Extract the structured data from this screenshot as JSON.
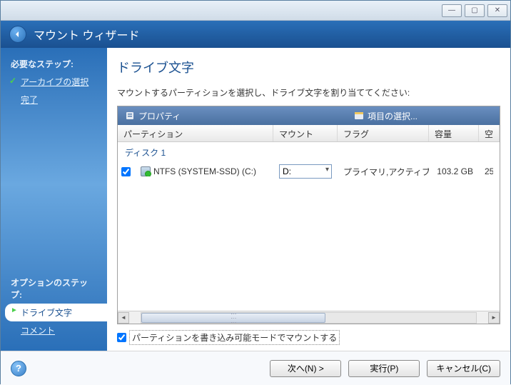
{
  "header": {
    "title": "マウント ウィザード"
  },
  "sidebar": {
    "required_heading": "必要なステップ:",
    "items": [
      {
        "label": "アーカイブの選択",
        "state": "checked"
      },
      {
        "label": "完了",
        "state": ""
      }
    ],
    "option_heading": "オプションのステップ:",
    "option_items": [
      {
        "label": "ドライブ文字",
        "state": "active"
      },
      {
        "label": "コメント",
        "state": ""
      }
    ]
  },
  "main": {
    "title": "ドライブ文字",
    "description": "マウントするパーティションを選択し、ドライブ文字を割り当ててください:",
    "toolbar": {
      "properties": "プロパティ",
      "select_items": "項目の選択..."
    },
    "columns": {
      "partition": "パーティション",
      "mount": "マウント ド...",
      "flag": "フラグ",
      "size": "容量",
      "extra": "空"
    },
    "disk_group": "ディスク 1",
    "rows": [
      {
        "checked": true,
        "partition": "NTFS (SYSTEM-SSD) (C:)",
        "mount": "D:",
        "flag": "プライマリ,アクティブ",
        "size": "103.2 GB",
        "extra": "25"
      }
    ],
    "rw_mount": {
      "checked": true,
      "label": "パーティションを書き込み可能モードでマウントする"
    }
  },
  "footer": {
    "next": "次へ(N) >",
    "exec": "実行(P)",
    "cancel": "キャンセル(C)"
  }
}
